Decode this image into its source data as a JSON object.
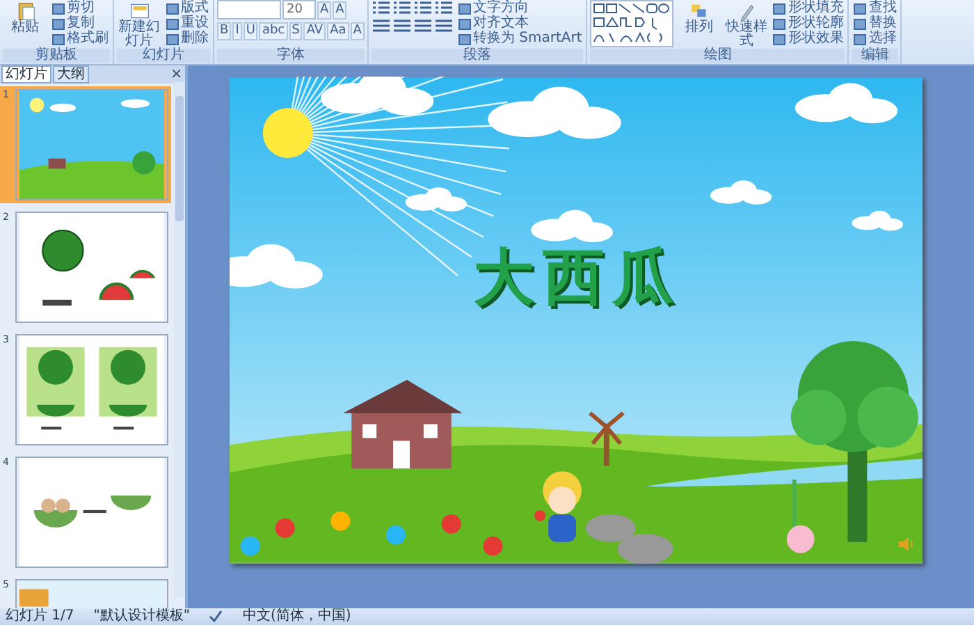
{
  "ribbon": {
    "groups": [
      {
        "kind": "clipboard",
        "label": "剪贴板",
        "big": "粘贴",
        "items": [
          "剪切",
          "复制",
          "格式刷"
        ]
      },
      {
        "kind": "slides",
        "label": "幻灯片",
        "big": "新建幻灯片",
        "items": [
          "版式",
          "重设",
          "删除"
        ]
      },
      {
        "kind": "font",
        "label": "字体",
        "font_size": "20",
        "grow": [
          "A",
          "A"
        ],
        "format": [
          "B",
          "I",
          "U",
          "abc",
          "S",
          "AV",
          "Aa",
          "A"
        ]
      },
      {
        "kind": "paragraph",
        "label": "段落",
        "items": [
          "文字方向",
          "对齐文本",
          "转换为 SmartArt"
        ]
      },
      {
        "kind": "drawing",
        "label": "绘图",
        "big": [
          "排列",
          "快速样式"
        ],
        "items": [
          "形状填充",
          "形状轮廓",
          "形状效果"
        ]
      },
      {
        "kind": "editing",
        "label": "编辑",
        "items": [
          "查找",
          "替换",
          "选择"
        ]
      }
    ]
  },
  "slides_pane": {
    "close": "×",
    "tabs": [
      {
        "label": "幻灯片",
        "selected": true
      },
      {
        "label": "大纲",
        "selected": false
      }
    ],
    "thumbnails": [
      {
        "number": "1",
        "kind": "title",
        "selected": true
      },
      {
        "number": "2",
        "kind": "melons",
        "selected": false
      },
      {
        "number": "3",
        "kind": "kids",
        "selected": false
      },
      {
        "number": "4",
        "kind": "bowls",
        "selected": false
      },
      {
        "number": "5",
        "kind": "partial",
        "selected": false
      }
    ]
  },
  "slide": {
    "title": "大西瓜"
  },
  "status_bar": {
    "slide": "幻灯片 1/7",
    "theme": "\"默认设计模板\"",
    "language": "中文(简体，中国)"
  }
}
